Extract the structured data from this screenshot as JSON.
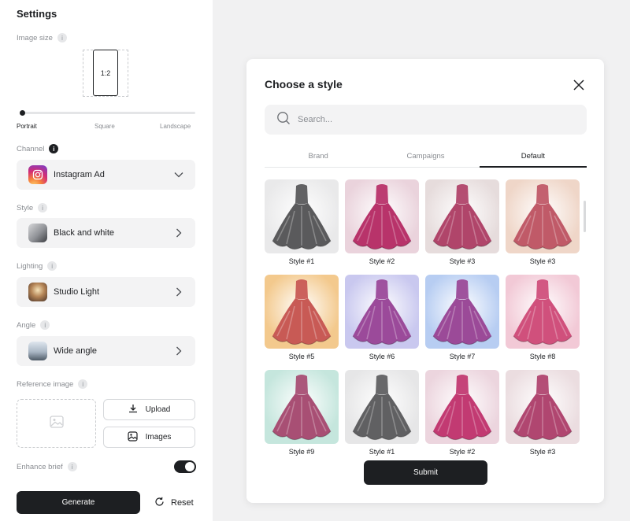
{
  "settings": {
    "title": "Settings",
    "image_size": {
      "label": "Image size",
      "ratio": "1:2",
      "slider_labels": [
        "Portrait",
        "Square",
        "Landscape"
      ],
      "slider_value": 0.0
    },
    "channel": {
      "label": "Channel",
      "value": "Instagram Ad"
    },
    "style": {
      "label": "Style",
      "value": "Black and white"
    },
    "lighting": {
      "label": "Lighting",
      "value": "Studio Light"
    },
    "angle": {
      "label": "Angle",
      "value": "Wide angle"
    },
    "reference_image": {
      "label": "Reference image",
      "upload_label": "Upload",
      "images_label": "Images"
    },
    "enhance_brief": {
      "label": "Enhance brief",
      "enabled": true
    },
    "generate_label": "Generate",
    "reset_label": "Reset"
  },
  "modal": {
    "title": "Choose a style",
    "search_placeholder": "Search...",
    "tabs": [
      "Brand",
      "Campaigns",
      "Default"
    ],
    "active_tab": "Default",
    "styles": [
      {
        "label": "Style #1",
        "bg": "#e9e9ea",
        "dress": "#5a5a5c"
      },
      {
        "label": "Style #2",
        "bg": "#ead3dc",
        "dress": "#b8336a"
      },
      {
        "label": "Style #3",
        "bg": "#e6dcdc",
        "dress": "#b0456a"
      },
      {
        "label": "Style #3",
        "bg": "#efd6c8",
        "dress": "#c05a68"
      },
      {
        "label": "Style #5",
        "bg": "#f3c98d",
        "dress": "#c85a55"
      },
      {
        "label": "Style #6",
        "bg": "#c9c8ef",
        "dress": "#9b4a9a"
      },
      {
        "label": "Style #7",
        "bg": "#b7cdf2",
        "dress": "#9b4a98"
      },
      {
        "label": "Style #8",
        "bg": "#f2c9d6",
        "dress": "#d0507c"
      },
      {
        "label": "Style #9",
        "bg": "#c5e6dd",
        "dress": "#a84f74"
      },
      {
        "label": "Style #1",
        "bg": "#e6e6e7",
        "dress": "#606062"
      },
      {
        "label": "Style #2",
        "bg": "#ecd5de",
        "dress": "#c23a72"
      },
      {
        "label": "Style #3",
        "bg": "#ebdde0",
        "dress": "#b04670"
      }
    ],
    "submit_label": "Submit"
  },
  "colors": {
    "primary": "#1d1f22",
    "muted": "#8a8d92",
    "field_bg": "#f3f3f4",
    "canvas_bg": "#f1f1f2"
  }
}
